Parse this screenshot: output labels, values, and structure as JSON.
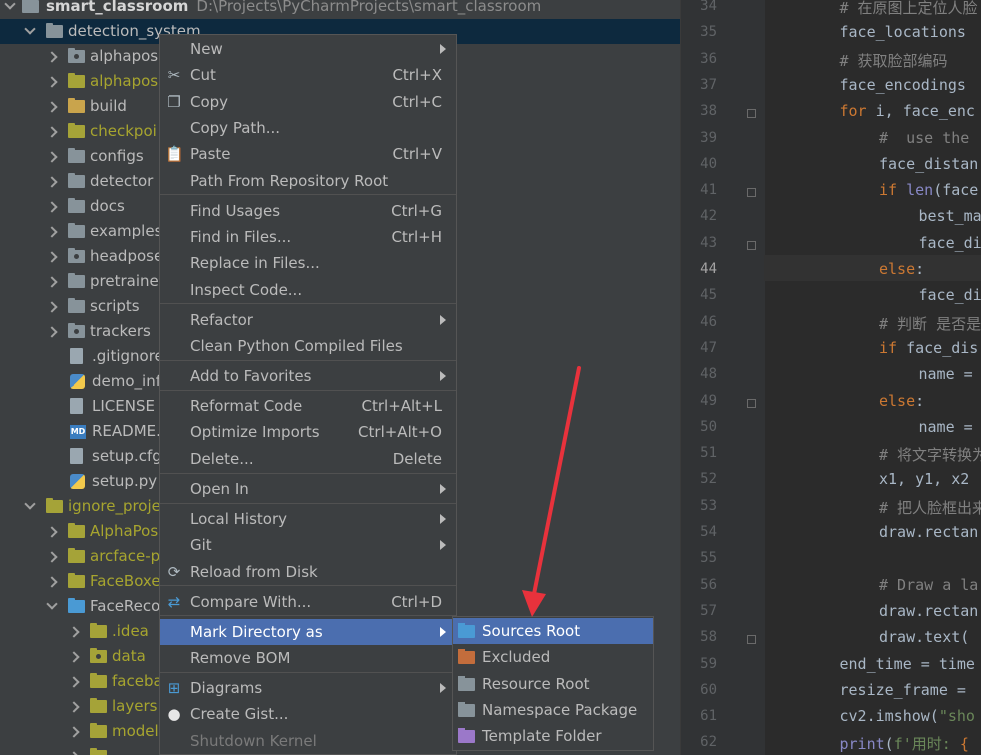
{
  "tree": {
    "root": {
      "label": "smart_classroom",
      "path": "D:\\Projects\\PyCharmProjects\\smart_classroom"
    },
    "rows": [
      {
        "label": "detection_system",
        "indent": 1,
        "type": "folder",
        "open": true,
        "selected": true
      },
      {
        "label": "alphapose",
        "indent": 2,
        "type": "folder-pkg",
        "open": false
      },
      {
        "label": "alphapose",
        "indent": 2,
        "type": "folder-y",
        "open": false
      },
      {
        "label": "build",
        "indent": 2,
        "type": "folder-o",
        "open": false
      },
      {
        "label": "checkpoi",
        "indent": 2,
        "type": "folder-y",
        "open": false
      },
      {
        "label": "configs",
        "indent": 2,
        "type": "folder",
        "open": false
      },
      {
        "label": "detector",
        "indent": 2,
        "type": "folder",
        "open": false
      },
      {
        "label": "docs",
        "indent": 2,
        "type": "folder",
        "open": false
      },
      {
        "label": "examples",
        "indent": 2,
        "type": "folder",
        "open": false
      },
      {
        "label": "headpose",
        "indent": 2,
        "type": "folder-pkg",
        "open": false
      },
      {
        "label": "pretraine",
        "indent": 2,
        "type": "folder",
        "open": false
      },
      {
        "label": "scripts",
        "indent": 2,
        "type": "folder",
        "open": false
      },
      {
        "label": "trackers",
        "indent": 2,
        "type": "folder-pkg",
        "open": false
      },
      {
        "label": ".gitignore",
        "indent": 3,
        "type": "file"
      },
      {
        "label": "demo_inf",
        "indent": 3,
        "type": "py"
      },
      {
        "label": "LICENSE",
        "indent": 3,
        "type": "file"
      },
      {
        "label": "README.",
        "indent": 3,
        "type": "md"
      },
      {
        "label": "setup.cfg",
        "indent": 3,
        "type": "file"
      },
      {
        "label": "setup.py",
        "indent": 3,
        "type": "py"
      },
      {
        "label": "ignore_proje",
        "indent": 1,
        "type": "folder-y",
        "open": true
      },
      {
        "label": "AlphaPos",
        "indent": 2,
        "type": "folder-y",
        "open": false
      },
      {
        "label": "arcface-p",
        "indent": 2,
        "type": "folder-y",
        "open": false
      },
      {
        "label": "FaceBoxe",
        "indent": 2,
        "type": "folder-y",
        "open": false
      },
      {
        "label": "FaceReco",
        "indent": 2,
        "type": "folder-b",
        "open": true
      },
      {
        "label": ".idea",
        "indent": 3,
        "type": "folder-y",
        "open": false
      },
      {
        "label": "data",
        "indent": 3,
        "type": "folder-pkg-y",
        "open": false
      },
      {
        "label": "faceba",
        "indent": 3,
        "type": "folder-y",
        "open": false
      },
      {
        "label": "layers",
        "indent": 3,
        "type": "folder-y",
        "open": false
      },
      {
        "label": "model",
        "indent": 3,
        "type": "folder-y",
        "open": false
      },
      {
        "label": "",
        "indent": 3,
        "type": "folder-y",
        "open": false
      }
    ]
  },
  "editor": {
    "current_line": "44",
    "lines": [
      {
        "n": "34",
        "indent": 2,
        "html_parts": [
          {
            "c": "cm",
            "t": "# 在原图上定位人脸"
          }
        ]
      },
      {
        "n": "35",
        "indent": 2,
        "html_parts": [
          {
            "c": "",
            "t": "face_locations"
          }
        ]
      },
      {
        "n": "36",
        "indent": 2,
        "html_parts": [
          {
            "c": "cm",
            "t": "# 获取脸部编码"
          }
        ]
      },
      {
        "n": "37",
        "indent": 2,
        "html_parts": [
          {
            "c": "",
            "t": "face_encodings"
          }
        ]
      },
      {
        "n": "38",
        "indent": 2,
        "html_parts": [
          {
            "c": "kw",
            "t": "for "
          },
          {
            "c": "",
            "t": "i, face_enc"
          }
        ]
      },
      {
        "n": "39",
        "indent": 3,
        "html_parts": [
          {
            "c": "cm",
            "t": "#  use the"
          }
        ]
      },
      {
        "n": "40",
        "indent": 3,
        "html_parts": [
          {
            "c": "",
            "t": "face_distan"
          }
        ]
      },
      {
        "n": "41",
        "indent": 3,
        "html_parts": [
          {
            "c": "kw",
            "t": "if "
          },
          {
            "c": "fn",
            "t": "len"
          },
          {
            "c": "",
            "t": "(face"
          }
        ]
      },
      {
        "n": "42",
        "indent": 4,
        "html_parts": [
          {
            "c": "",
            "t": "best_ma"
          }
        ]
      },
      {
        "n": "43",
        "indent": 4,
        "html_parts": [
          {
            "c": "",
            "t": "face_di"
          }
        ]
      },
      {
        "n": "44",
        "indent": 3,
        "html_parts": [
          {
            "c": "kw",
            "t": "else"
          },
          {
            "c": "",
            "t": ":"
          }
        ]
      },
      {
        "n": "45",
        "indent": 4,
        "html_parts": [
          {
            "c": "",
            "t": "face_di"
          }
        ]
      },
      {
        "n": "46",
        "indent": 3,
        "html_parts": [
          {
            "c": "cm",
            "t": "# 判断 是否是"
          }
        ]
      },
      {
        "n": "47",
        "indent": 3,
        "html_parts": [
          {
            "c": "kw",
            "t": "if "
          },
          {
            "c": "",
            "t": "face_dis"
          }
        ]
      },
      {
        "n": "48",
        "indent": 4,
        "html_parts": [
          {
            "c": "",
            "t": "name ="
          }
        ]
      },
      {
        "n": "49",
        "indent": 3,
        "html_parts": [
          {
            "c": "kw",
            "t": "else"
          },
          {
            "c": "",
            "t": ":"
          }
        ]
      },
      {
        "n": "50",
        "indent": 4,
        "html_parts": [
          {
            "c": "",
            "t": "name ="
          }
        ]
      },
      {
        "n": "51",
        "indent": 3,
        "html_parts": [
          {
            "c": "cm",
            "t": "# 将文字转换为"
          }
        ]
      },
      {
        "n": "52",
        "indent": 3,
        "html_parts": [
          {
            "c": "",
            "t": "x1, y1, x2"
          }
        ]
      },
      {
        "n": "53",
        "indent": 3,
        "html_parts": [
          {
            "c": "cm",
            "t": "# 把人脸框出来"
          }
        ]
      },
      {
        "n": "54",
        "indent": 3,
        "html_parts": [
          {
            "c": "",
            "t": "draw.rectan"
          }
        ]
      },
      {
        "n": "55",
        "indent": 3,
        "html_parts": [
          {
            "c": "",
            "t": ""
          }
        ]
      },
      {
        "n": "56",
        "indent": 3,
        "html_parts": [
          {
            "c": "cm",
            "t": "# Draw a la"
          }
        ]
      },
      {
        "n": "57",
        "indent": 3,
        "html_parts": [
          {
            "c": "",
            "t": "draw.rectan"
          }
        ]
      },
      {
        "n": "58",
        "indent": 3,
        "html_parts": [
          {
            "c": "",
            "t": "draw.text("
          }
        ]
      },
      {
        "n": "59",
        "indent": 2,
        "html_parts": [
          {
            "c": "",
            "t": "end_time = time"
          }
        ]
      },
      {
        "n": "60",
        "indent": 2,
        "html_parts": [
          {
            "c": "",
            "t": "resize_frame ="
          }
        ]
      },
      {
        "n": "61",
        "indent": 2,
        "html_parts": [
          {
            "c": "",
            "t": "cv2.imshow("
          },
          {
            "c": "st",
            "t": "\"sho"
          }
        ]
      },
      {
        "n": "62",
        "indent": 2,
        "html_parts": [
          {
            "c": "fn",
            "t": "print"
          },
          {
            "c": "",
            "t": "("
          },
          {
            "c": "st",
            "t": "f'用时: "
          },
          {
            "c": "kw",
            "t": "{"
          }
        ]
      }
    ]
  },
  "menu": {
    "items": [
      {
        "label": "New",
        "u": 0,
        "shortcut": "",
        "submenu": true,
        "icon": ""
      },
      {
        "label": "Cut",
        "u": 1,
        "shortcut": "Ctrl+X",
        "icon": "✂",
        "icon_name": "scissors-icon"
      },
      {
        "label": "Copy",
        "u": 0,
        "shortcut": "Ctrl+C",
        "icon": "❐",
        "icon_name": "copy-icon"
      },
      {
        "label": "Copy Path...",
        "shortcut": "",
        "icon": ""
      },
      {
        "label": "Paste",
        "u": 0,
        "shortcut": "Ctrl+V",
        "icon": "📋",
        "icon_name": "clipboard-icon"
      },
      {
        "label": "Path From Repository Root",
        "shortcut": "",
        "icon": ""
      },
      {
        "sep": true
      },
      {
        "label": "Find Usages",
        "shortcut": "Ctrl+G",
        "icon": ""
      },
      {
        "label": "Find in Files...",
        "shortcut": "Ctrl+H",
        "icon": ""
      },
      {
        "label": "Replace in Files...",
        "shortcut": "",
        "icon": ""
      },
      {
        "label": "Inspect Code...",
        "shortcut": "",
        "icon": ""
      },
      {
        "sep": true
      },
      {
        "label": "Refactor",
        "shortcut": "",
        "submenu": true,
        "icon": ""
      },
      {
        "label": "Clean Python Compiled Files",
        "shortcut": "",
        "icon": ""
      },
      {
        "sep": true
      },
      {
        "label": "Add to Favorites",
        "shortcut": "",
        "submenu": true,
        "icon": ""
      },
      {
        "sep": true
      },
      {
        "label": "Reformat Code",
        "shortcut": "Ctrl+Alt+L",
        "icon": ""
      },
      {
        "label": "Optimize Imports",
        "shortcut": "Ctrl+Alt+O",
        "icon": ""
      },
      {
        "label": "Delete...",
        "shortcut": "Delete",
        "icon": ""
      },
      {
        "sep": true
      },
      {
        "label": "Open In",
        "shortcut": "",
        "submenu": true,
        "icon": ""
      },
      {
        "sep": true
      },
      {
        "label": "Local History",
        "shortcut": "",
        "submenu": true,
        "icon": ""
      },
      {
        "label": "Git",
        "shortcut": "",
        "submenu": true,
        "icon": ""
      },
      {
        "label": "Reload from Disk",
        "shortcut": "",
        "icon": "⟳",
        "icon_name": "reload-icon"
      },
      {
        "sep": true
      },
      {
        "label": "Compare With...",
        "shortcut": "Ctrl+D",
        "icon": "⇄",
        "icon_name": "compare-icon"
      },
      {
        "sep": true
      },
      {
        "label": "Mark Directory as",
        "shortcut": "",
        "submenu": true,
        "selected": true,
        "icon": ""
      },
      {
        "label": "Remove BOM",
        "shortcut": "",
        "icon": ""
      },
      {
        "sep": true
      },
      {
        "label": "Diagrams",
        "shortcut": "",
        "submenu": true,
        "icon": "⊞",
        "icon_name": "diagram-icon"
      },
      {
        "label": "Create Gist...",
        "shortcut": "",
        "icon": "●",
        "icon_name": "github-icon"
      },
      {
        "label": "Shutdown Kernel",
        "shortcut": "",
        "disabled": true,
        "icon": ""
      }
    ]
  },
  "submenu": {
    "items": [
      {
        "label": "Sources Root",
        "color": "#4a9ad4",
        "selected": true,
        "icon_name": "sources-root-folder-icon"
      },
      {
        "label": "Excluded",
        "color": "#c36d3c",
        "icon_name": "excluded-folder-icon"
      },
      {
        "label": "Resource Root",
        "color": "#87939a",
        "icon_name": "resource-root-folder-icon"
      },
      {
        "label": "Namespace Package",
        "color": "#87939a",
        "icon_name": "namespace-package-folder-icon"
      },
      {
        "label": "Template Folder",
        "color": "#9b78c9",
        "icon_name": "template-folder-icon"
      }
    ]
  },
  "colors": {
    "selection": "#4b6eaf",
    "tree_bg": "#3c3f41",
    "editor_bg": "#2b2b2b",
    "annotation_arrow": "#e8323c"
  }
}
